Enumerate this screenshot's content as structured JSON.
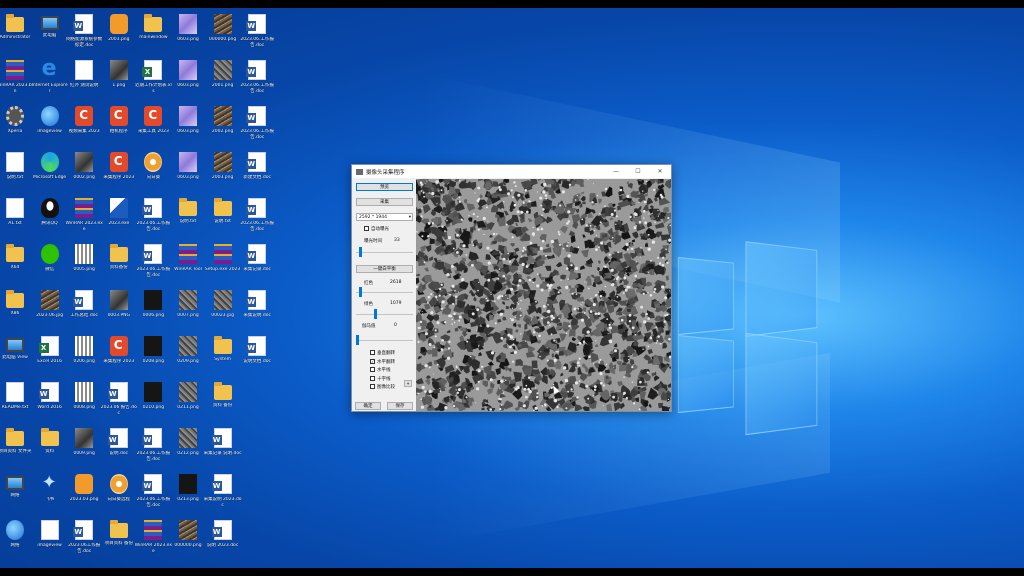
{
  "desktop": {
    "icons": [
      {
        "label": "Administrator",
        "kind": "folder"
      },
      {
        "label": "此电脑",
        "kind": "pc"
      },
      {
        "label": "网络能源系统参数标定.doc",
        "kind": "doc"
      },
      {
        "label": "2003.png",
        "kind": "orange"
      },
      {
        "label": "mainwindow",
        "kind": "folder"
      },
      {
        "label": "0603.png",
        "kind": "purp"
      },
      {
        "label": "000000.png",
        "kind": "tex2"
      },
      {
        "label": "2023.06.工作报告.doc",
        "kind": "doc"
      },
      {
        "label": "WinRAR 2023.bin",
        "kind": "rar"
      },
      {
        "label": "Internet Explorer",
        "kind": "ie"
      },
      {
        "label": "红外 测试说明",
        "kind": "blank"
      },
      {
        "label": "1.png",
        "kind": "img"
      },
      {
        "label": "近期工作计划表.xls",
        "kind": "xls"
      },
      {
        "label": "0603.png",
        "kind": "purp"
      },
      {
        "label": "2001.png",
        "kind": "tex"
      },
      {
        "label": "2023.06.工作报告.doc",
        "kind": "doc"
      },
      {
        "label": "Xperia",
        "kind": "gear"
      },
      {
        "label": "imageview",
        "kind": "globe"
      },
      {
        "label": "视频采集 2023",
        "kind": "red"
      },
      {
        "label": "相机程序",
        "kind": "red"
      },
      {
        "label": "采集工具 2023",
        "kind": "red"
      },
      {
        "label": "0603.png",
        "kind": "purp"
      },
      {
        "label": "2002.png",
        "kind": "tex2"
      },
      {
        "label": "2023.06.工作报告.doc",
        "kind": "doc"
      },
      {
        "label": "说明.txt",
        "kind": "blank"
      },
      {
        "label": "Microsoft Edge",
        "kind": "edge"
      },
      {
        "label": "0002.png",
        "kind": "img"
      },
      {
        "label": "采集程序 2023",
        "kind": "red"
      },
      {
        "label": "向日葵",
        "kind": "sun"
      },
      {
        "label": "0603.png",
        "kind": "purp"
      },
      {
        "label": "2003.png",
        "kind": "tex2"
      },
      {
        "label": "新建文档.doc",
        "kind": "doc"
      },
      {
        "label": "A1.txt",
        "kind": "blank"
      },
      {
        "label": "腾讯QQ",
        "kind": "qq"
      },
      {
        "label": "WinRAR 2023.exe",
        "kind": "rar"
      },
      {
        "label": "2023.exe",
        "kind": "sci"
      },
      {
        "label": "2023.06.工作报告.doc",
        "kind": "doc"
      },
      {
        "label": "说明.txt",
        "kind": "folder"
      },
      {
        "label": "说明.txt",
        "kind": "folder"
      },
      {
        "label": "2023.06.工作报告.doc",
        "kind": "doc"
      },
      {
        "label": "X64",
        "kind": "folder"
      },
      {
        "label": "微信",
        "kind": "wechat"
      },
      {
        "label": "0005.png",
        "kind": "grid"
      },
      {
        "label": "资料备份",
        "kind": "folder"
      },
      {
        "label": "2023.06.工作报告.doc",
        "kind": "doc"
      },
      {
        "label": "WinRAR Tool",
        "kind": "rar"
      },
      {
        "label": "Setup.exe 2023",
        "kind": "rar"
      },
      {
        "label": "采集记录.doc",
        "kind": "doc"
      },
      {
        "label": "X86",
        "kind": "folder"
      },
      {
        "label": "2023.06.jpg",
        "kind": "tex2"
      },
      {
        "label": "工作总结.doc",
        "kind": "doc"
      },
      {
        "label": "0003.PNG",
        "kind": "img"
      },
      {
        "label": "0006.png",
        "kind": "dark"
      },
      {
        "label": "0007.png",
        "kind": "tex"
      },
      {
        "label": "00023.jpg",
        "kind": "tex"
      },
      {
        "label": "采集说明.doc",
        "kind": "doc"
      },
      {
        "label": "此电脑 View",
        "kind": "pc"
      },
      {
        "label": "Excel 2016",
        "kind": "xls"
      },
      {
        "label": "0206.png",
        "kind": "grid"
      },
      {
        "label": "采集程序 2023",
        "kind": "red"
      },
      {
        "label": "0208.png",
        "kind": "dark"
      },
      {
        "label": "0209.png",
        "kind": "tex"
      },
      {
        "label": "System",
        "kind": "folder"
      },
      {
        "label": "说明文档.doc",
        "kind": "doc"
      },
      {
        "label": "READMe.txt",
        "kind": "blank"
      },
      {
        "label": "Word 2016",
        "kind": "doc"
      },
      {
        "label": "0008.png",
        "kind": "grid"
      },
      {
        "label": "2023.06 报告.doc",
        "kind": "doc"
      },
      {
        "label": "0210.png",
        "kind": "dark"
      },
      {
        "label": "0211.png",
        "kind": "tex"
      },
      {
        "label": "资料 备份",
        "kind": "folder"
      },
      {
        "label": "",
        "kind": "none"
      },
      {
        "label": "项目资料 文件夹",
        "kind": "folder"
      },
      {
        "label": "资料",
        "kind": "folder"
      },
      {
        "label": "0009.png",
        "kind": "img"
      },
      {
        "label": "说明.doc",
        "kind": "doc"
      },
      {
        "label": "2023.06.工作报告.doc",
        "kind": "doc"
      },
      {
        "label": "0212.png",
        "kind": "tex"
      },
      {
        "label": "采集记录 说明.doc",
        "kind": "doc"
      },
      {
        "label": "",
        "kind": "none"
      },
      {
        "label": "网络",
        "kind": "pc"
      },
      {
        "label": "飞书",
        "kind": "bird"
      },
      {
        "label": "2023.03.png",
        "kind": "orange"
      },
      {
        "label": "向日葵远程",
        "kind": "sun"
      },
      {
        "label": "2023.06.工作报告.doc",
        "kind": "doc"
      },
      {
        "label": "0213.png",
        "kind": "dark"
      },
      {
        "label": "采集说明 2023.doc",
        "kind": "doc"
      },
      {
        "label": "",
        "kind": "none"
      },
      {
        "label": "网络",
        "kind": "globe"
      },
      {
        "label": "imageview",
        "kind": "blank"
      },
      {
        "label": "2023.06工作报告.doc",
        "kind": "doc"
      },
      {
        "label": "项目资料 备份",
        "kind": "folder"
      },
      {
        "label": "WinRAR 2023.exe",
        "kind": "rar"
      },
      {
        "label": "000000.png",
        "kind": "tex2"
      },
      {
        "label": "说明 2023.doc",
        "kind": "doc"
      },
      {
        "label": "",
        "kind": "none"
      }
    ]
  },
  "window": {
    "title": "摄像头采集程序",
    "minimize": "—",
    "maximize": "☐",
    "close": "✕",
    "buttons": {
      "preview": "预览",
      "capture": "采集",
      "white_balance": "一键白平衡",
      "ok": "确定",
      "save": "保存"
    },
    "resolution": "2592 * 1944",
    "auto_exposure": {
      "label": "自动曝光",
      "checked": false
    },
    "exposure": {
      "label": "曝光时间",
      "value": "33",
      "level": 0.05
    },
    "red": {
      "label": "红色",
      "value": "2618",
      "level": 0.06
    },
    "green": {
      "label": "绿色",
      "value": "1079",
      "level": 0.33
    },
    "gamma": {
      "label": "伽马值",
      "value": "0",
      "level": 0.0
    },
    "options": [
      {
        "label": "垂直翻转",
        "checked": false
      },
      {
        "label": "水平翻转",
        "checked": true
      },
      {
        "label": "水平线",
        "checked": false
      },
      {
        "label": "十字线",
        "checked": false
      },
      {
        "label": "图像比较",
        "checked": false
      }
    ],
    "spin_label": "+"
  },
  "colors": {
    "accent": "#0078d7",
    "desktop": "#0b5cc9"
  }
}
